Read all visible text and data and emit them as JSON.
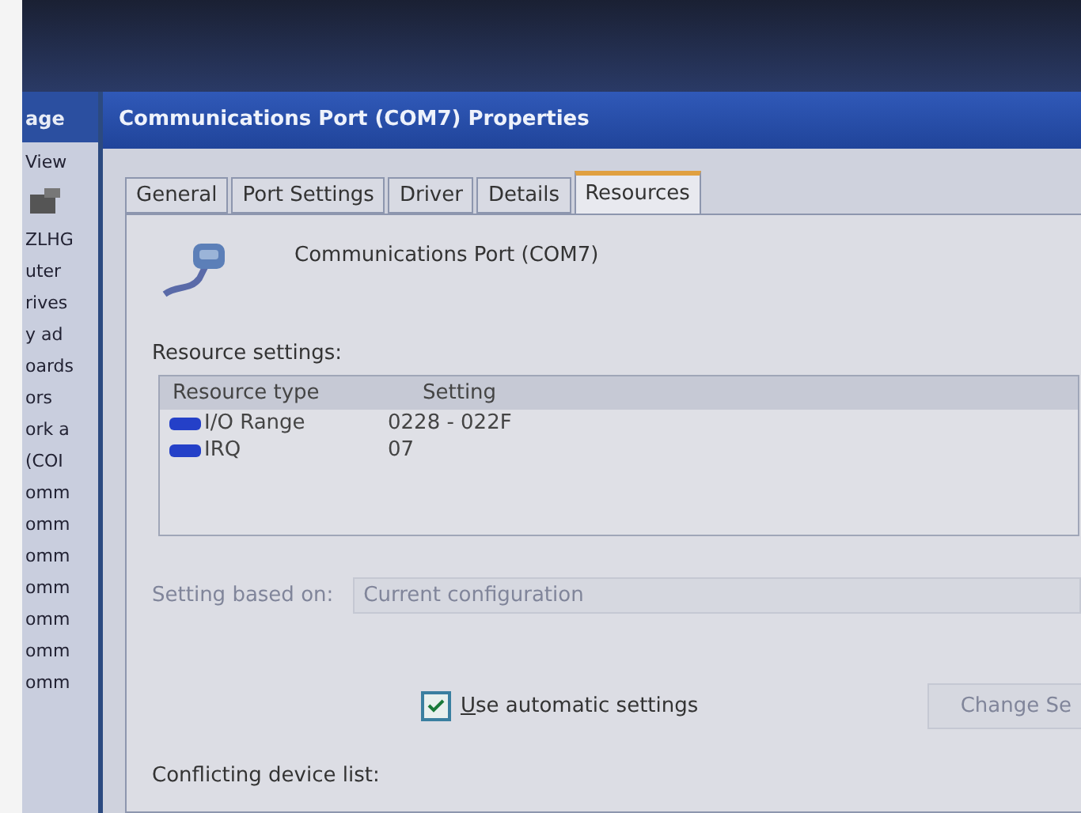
{
  "background_window": {
    "title": "age",
    "menu": "View",
    "items": [
      "ZLHG",
      "uter",
      "rives",
      "y ad",
      "oards",
      "ors",
      "ork a",
      "(COI",
      "omm",
      "omm",
      "omm",
      "omm",
      "omm",
      "omm",
      "omm"
    ]
  },
  "window": {
    "title": "Communications Port (COM7) Properties"
  },
  "tabs": [
    {
      "label": "General",
      "selected": false
    },
    {
      "label": "Port Settings",
      "selected": false
    },
    {
      "label": "Driver",
      "selected": false
    },
    {
      "label": "Details",
      "selected": false
    },
    {
      "label": "Resources",
      "selected": true
    }
  ],
  "device": {
    "name": "Communications Port (COM7)"
  },
  "resource_settings": {
    "label": "Resource settings:",
    "columns": [
      "Resource type",
      "Setting"
    ],
    "rows": [
      {
        "type": "I/O Range",
        "setting": "0228 - 022F"
      },
      {
        "type": "IRQ",
        "setting": "07"
      }
    ]
  },
  "setting_based_on": {
    "label": "Setting based on:",
    "value": "Current configuration",
    "disabled": true
  },
  "use_automatic_settings": {
    "label": "Use automatic settings",
    "checked": true
  },
  "change_setting_button": {
    "label": "Change Se",
    "disabled": true
  },
  "conflicting_label": "Conflicting device list:"
}
